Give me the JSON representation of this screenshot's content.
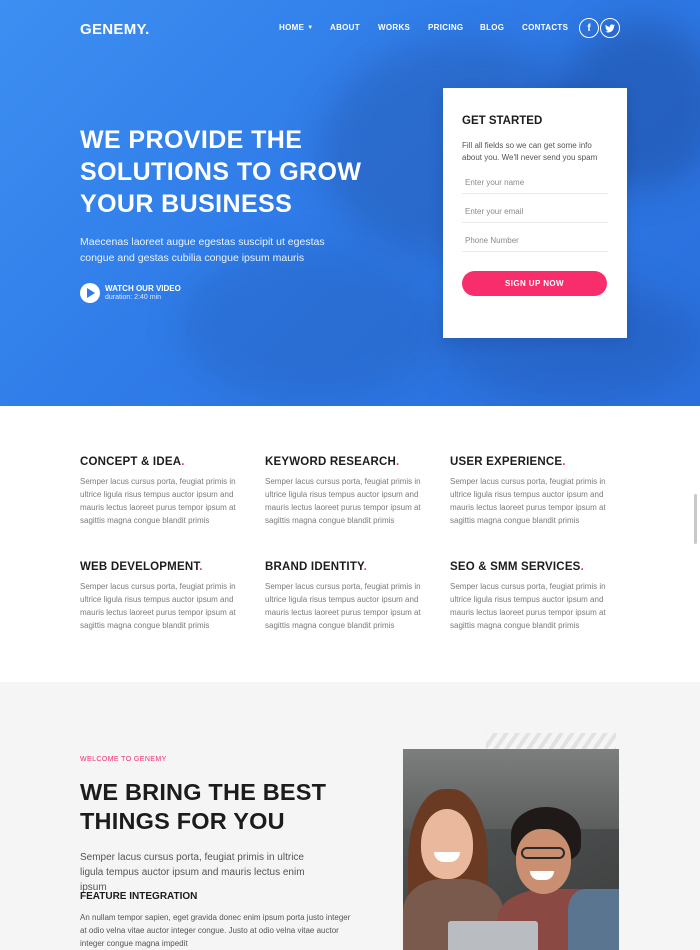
{
  "header": {
    "logo": "GENEMY.",
    "nav": [
      {
        "label": "HOME",
        "dropdown": true
      },
      {
        "label": "ABOUT"
      },
      {
        "label": "WORKS"
      },
      {
        "label": "PRICING"
      },
      {
        "label": "BLOG"
      },
      {
        "label": "CONTACTS"
      }
    ],
    "social": [
      {
        "icon": "facebook-icon",
        "glyph": "f"
      },
      {
        "icon": "twitter-icon",
        "glyph": "t"
      }
    ]
  },
  "hero": {
    "title": "WE PROVIDE THE SOLUTIONS TO GROW YOUR BUSINESS",
    "subtitle": "Maecenas laoreet augue egestas suscipit ut egestas congue and gestas cubilia congue ipsum mauris",
    "video_label": "WATCH OUR VIDEO",
    "video_duration": "duration: 2:40 min"
  },
  "form": {
    "title": "GET STARTED",
    "description": "Fill all fields so we can get some info about you. We'll never send you spam",
    "name_placeholder": "Enter your name",
    "email_placeholder": "Enter your email",
    "phone_placeholder": "Phone Number",
    "submit_label": "SIGN UP NOW"
  },
  "services": [
    {
      "title": "CONCEPT & IDEA",
      "text": "Semper lacus cursus porta, feugiat primis in ultrice ligula risus tempus auctor ipsum and mauris lectus laoreet purus tempor ipsum at sagittis magna congue blandit primis"
    },
    {
      "title": "KEYWORD RESEARCH",
      "text": "Semper lacus cursus porta, feugiat primis in ultrice ligula risus tempus auctor ipsum and mauris lectus laoreet purus tempor ipsum at sagittis magna congue blandit primis"
    },
    {
      "title": "USER EXPERIENCE",
      "text": "Semper lacus cursus porta, feugiat primis in ultrice ligula risus tempus auctor ipsum and mauris lectus laoreet purus tempor ipsum at sagittis magna congue blandit primis"
    },
    {
      "title": "WEB DEVELOPMENT",
      "text": "Semper lacus cursus porta, feugiat primis in ultrice ligula risus tempus auctor ipsum and mauris lectus laoreet purus tempor ipsum at sagittis magna congue blandit primis"
    },
    {
      "title": "BRAND IDENTITY",
      "text": "Semper lacus cursus porta, feugiat primis in ultrice ligula risus tempus auctor ipsum and mauris lectus laoreet purus tempor ipsum at sagittis magna congue blandit primis"
    },
    {
      "title": "SEO & SMM SERVICES",
      "text": "Semper lacus cursus porta, feugiat primis in ultrice ligula risus tempus auctor ipsum and mauris lectus laoreet purus tempor ipsum at sagittis magna congue blandit primis"
    }
  ],
  "about": {
    "eyebrow": "WELCOME TO GENEMY",
    "title": "WE BRING THE BEST THINGS FOR YOU",
    "text": "Semper lacus cursus porta, feugiat primis in ultrice ligula tempus auctor ipsum and mauris lectus enim ipsum",
    "feature_title": "FEATURE INTEGRATION",
    "feature_text": "An nullam tempor sapien, eget gravida donec enim ipsum porta justo integer at odio velna vitae auctor integer congue. Justo at odio velna vitae auctor integer congue magna impedit"
  },
  "colors": {
    "accent": "#f72d6c",
    "hero_blue": "#2f7be8",
    "dark_text": "#1c1c1c"
  }
}
